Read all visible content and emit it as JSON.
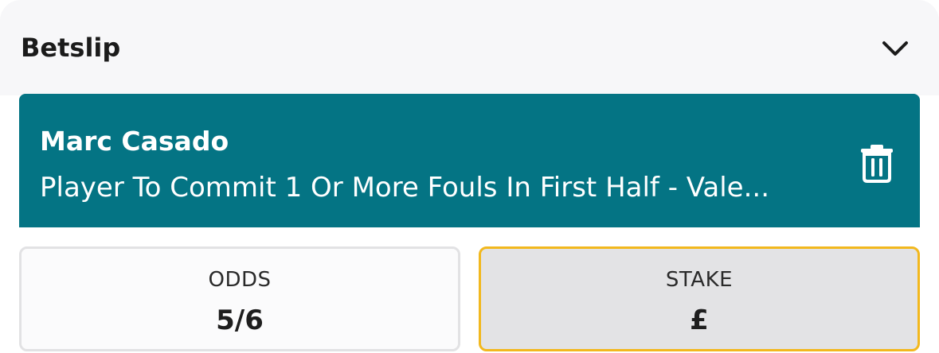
{
  "header": {
    "title": "Betslip",
    "collapse_icon": "chevron-down-icon"
  },
  "selection": {
    "name": "Marc Casado",
    "market": "Player To Commit 1 Or More Fouls In First Half - Vale...",
    "delete_icon": "trash-icon",
    "background_color": "#047484"
  },
  "odds": {
    "label": "ODDS",
    "value": "5/6"
  },
  "stake": {
    "label": "STAKE",
    "value": "£",
    "border_color": "#f2b81e"
  }
}
